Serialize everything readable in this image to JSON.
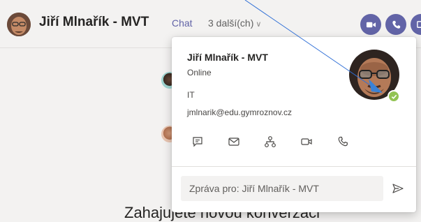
{
  "header": {
    "title": "Jiří Mlnařík - MVT",
    "tab_chat": "Chat",
    "tab_more": "3 další(ch)"
  },
  "chat": {
    "conversation_text": "Zahajujete novou konverzaci"
  },
  "contact_card": {
    "name": "Jiří Mlnařík - MVT",
    "status": "Online",
    "department": "IT",
    "email": "jmlnarik@edu.gymroznov.cz",
    "message_placeholder": "Zpráva pro: Jiří Mlnařík - MVT",
    "presence": "available"
  },
  "colors": {
    "accent": "#6264a7",
    "presence_available": "#92c353",
    "annotation_line": "#2f6fd6"
  },
  "icons": [
    "video-call-icon",
    "audio-call-icon",
    "share-screen-icon",
    "chat-icon",
    "mail-icon",
    "org-chart-icon",
    "video-icon",
    "phone-icon",
    "send-icon",
    "chevron-down-icon"
  ]
}
